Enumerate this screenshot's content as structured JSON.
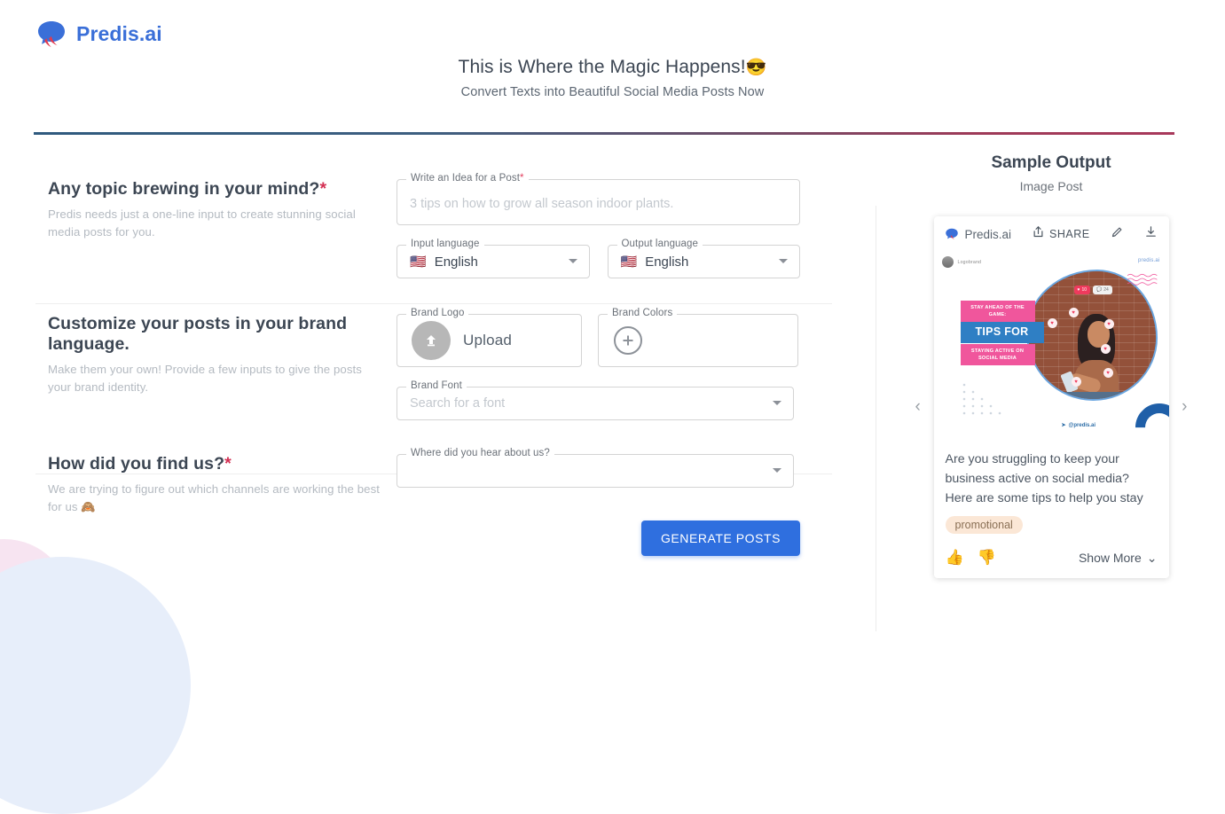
{
  "brand": {
    "name": "Predis.ai",
    "logo_icon": "speech-bubble-logo"
  },
  "hero": {
    "title": "This is Where the Magic Happens!",
    "title_emoji": "😎",
    "subtitle": "Convert Texts into Beautiful Social Media Posts Now",
    "rule_color_start": "#2f5a7e",
    "rule_color_end": "#a8395b"
  },
  "sections": [
    {
      "title": "Any topic brewing in your mind?",
      "required_mark": "*",
      "description": "Predis needs just a one-line input to create stunning social media posts for you."
    },
    {
      "title": "Customize your posts in your brand language.",
      "required_mark": "",
      "description": "Make them your own! Provide a few inputs to give the posts your brand identity."
    },
    {
      "title": "How did you find us?",
      "required_mark": "*",
      "description": "We are trying to figure out which channels are working the best for us 🙈"
    }
  ],
  "fields": {
    "idea": {
      "legend": "Write an Idea for a Post",
      "required_mark": "*",
      "value": "",
      "placeholder": "3 tips on how to grow all season indoor plants."
    },
    "input_language": {
      "legend": "Input language",
      "flag": "🇺🇸",
      "value": "English"
    },
    "output_language": {
      "legend": "Output language",
      "flag": "🇺🇸",
      "value": "English"
    },
    "brand_logo": {
      "legend": "Brand Logo",
      "upload_label": "Upload",
      "icon": "upload-arrow-icon"
    },
    "brand_colors": {
      "legend": "Brand Colors",
      "icon": "plus-circle-icon"
    },
    "brand_font": {
      "legend": "Brand Font",
      "value": "",
      "placeholder": "Search for a font"
    },
    "hear_about_us": {
      "legend": "Where did you hear about us?",
      "value": ""
    }
  },
  "generate_button": {
    "label": "GENERATE POSTS",
    "color": "#2f6fdf"
  },
  "sample_output": {
    "title": "Sample Output",
    "subtitle": "Image Post",
    "card": {
      "brand_label": "Predis.ai",
      "share_label": "SHARE",
      "edit_icon": "pencil-icon",
      "download_icon": "download-icon",
      "prev_icon": "chevron-left-icon",
      "next_icon": "chevron-right-icon",
      "post": {
        "brand_name": "Logobrand",
        "watermark": "predis.ai",
        "headline_top": "STAY AHEAD OF THE GAME:",
        "headline_mid": "TIPS FOR",
        "headline_bottom": "STAYING ACTIVE ON SOCIAL MEDIA",
        "handle": "@predis.ai",
        "like_count": "10",
        "comment_count": "24",
        "color_pink": "#f0569c",
        "color_blue": "#2f7fc4"
      },
      "caption": "Are you struggling to keep your business active on social media? Here are some tips to help you stay",
      "tag": "promotional",
      "like_icon": "thumbs-up-icon",
      "dislike_icon": "thumbs-down-icon",
      "show_more_label": "Show More"
    }
  }
}
